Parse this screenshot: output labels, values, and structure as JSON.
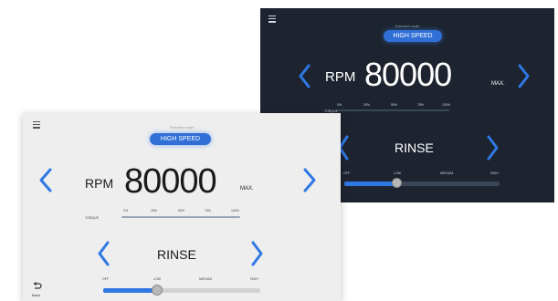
{
  "dark_screen": {
    "mode_caption": "Selected mode",
    "mode_button": "HIGH SPEED",
    "rpm_label": "RPM",
    "rpm_value": "80000",
    "rpm_max": "MAX.",
    "torque_label": "TORQUE",
    "torque_ticks": [
      "0%",
      "25%",
      "50%",
      "75%",
      "100%"
    ],
    "program_name": "RINSE",
    "speed_levels": [
      "OFF",
      "LOW",
      "MEDIUM",
      "HIGH"
    ],
    "speed_level_fraction": 0.33
  },
  "light_screen": {
    "mode_caption": "Selected mode",
    "mode_button": "HIGH SPEED",
    "rpm_label": "RPM",
    "rpm_value": "80000",
    "rpm_max": "MAX.",
    "torque_label": "TORQUE",
    "torque_ticks": [
      "0%",
      "25%",
      "50%",
      "75%",
      "100%"
    ],
    "program_name": "RINSE",
    "speed_levels": [
      "OFF",
      "LOW",
      "MEDIUM",
      "HIGH"
    ],
    "speed_level_fraction": 0.33,
    "back_label": "Back"
  },
  "colors": {
    "accent": "#2f78e4",
    "dark_bg": "#1d2430",
    "light_bg": "#eeeeee"
  }
}
